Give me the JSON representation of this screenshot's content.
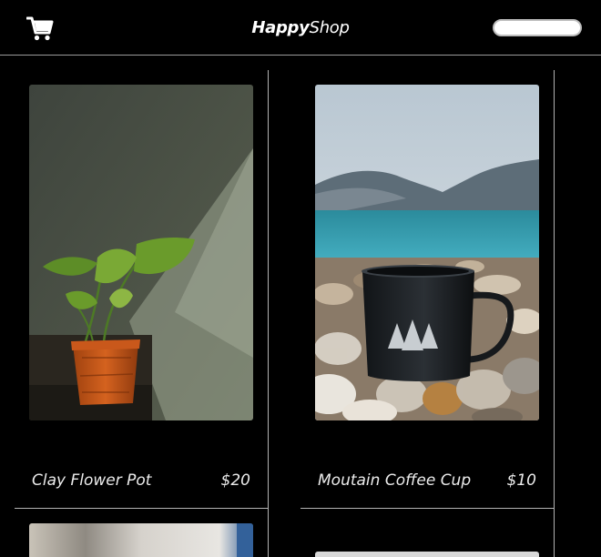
{
  "header": {
    "brand_bold": "Happy",
    "brand_light": "Shop",
    "cart_icon": "shopping-cart-icon",
    "search": {
      "value": "",
      "placeholder": ""
    }
  },
  "products": [
    {
      "name": "Clay Flower Pot",
      "price": "$20",
      "image": "potted-plant-photo"
    },
    {
      "name": "Moutain Coffee Cup",
      "price": "$10",
      "image": "camping-mug-photo"
    }
  ],
  "colors": {
    "background": "#000000",
    "text": "#ececec",
    "divider": "#b3b3b3"
  }
}
